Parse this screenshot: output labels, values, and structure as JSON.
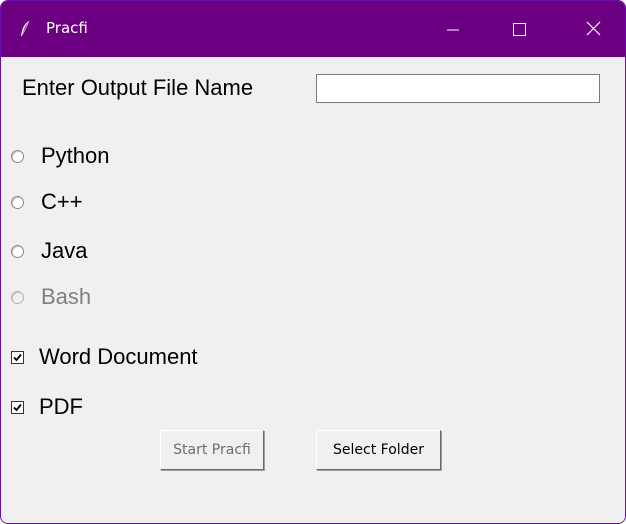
{
  "window": {
    "title": "Pracfi",
    "accent_color": "#6b0082",
    "controls": [
      "minimize-icon",
      "maximize-icon",
      "close-icon"
    ]
  },
  "output": {
    "label": "Enter Output File Name",
    "value": "",
    "placeholder": ""
  },
  "languages": [
    {
      "label": "Python",
      "selected": false,
      "enabled": true
    },
    {
      "label": "C++",
      "selected": false,
      "enabled": true
    },
    {
      "label": "Java",
      "selected": false,
      "enabled": true
    },
    {
      "label": "Bash",
      "selected": false,
      "enabled": false
    }
  ],
  "formats": [
    {
      "label": "Word Document",
      "checked": true
    },
    {
      "label": "PDF",
      "checked": true
    }
  ],
  "buttons": {
    "start": {
      "label": "Start Pracfi",
      "enabled": false
    },
    "select_folder": {
      "label": "Select Folder",
      "enabled": true
    }
  }
}
